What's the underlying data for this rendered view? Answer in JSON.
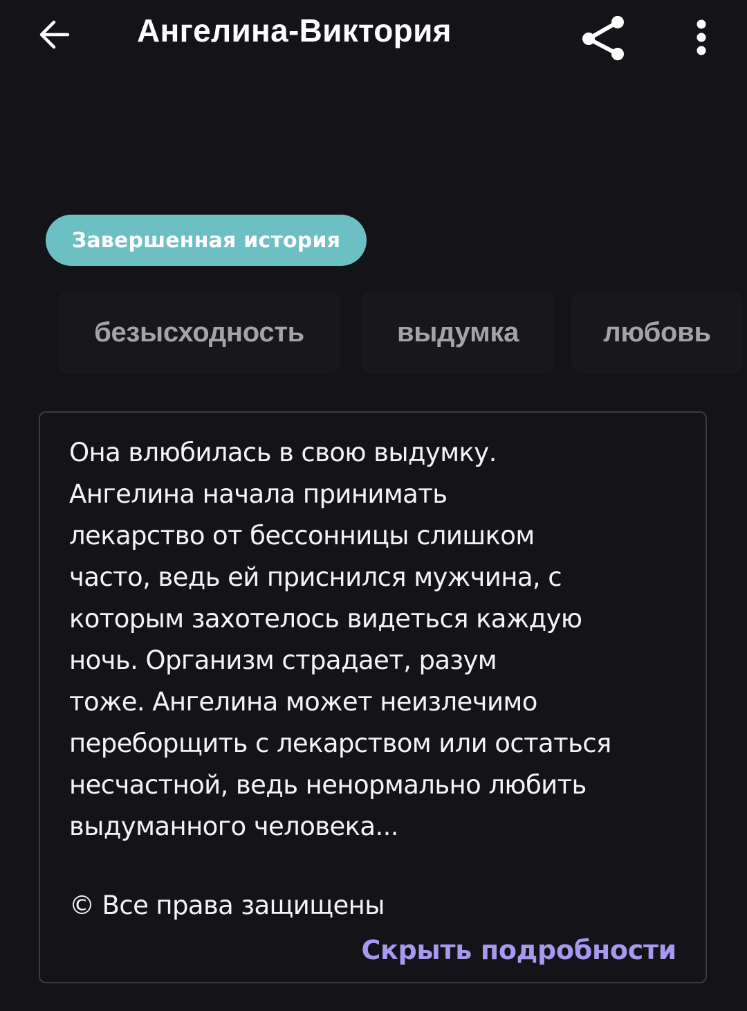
{
  "header": {
    "title": "Ангелина-Виктория",
    "back_icon": "arrow-left-icon",
    "share_icon": "share-icon",
    "more_icon": "more-vertical-icon"
  },
  "status_badge": {
    "label": "Завершенная история",
    "color": "#6cbfc3"
  },
  "tags": [
    {
      "label": "безысходность"
    },
    {
      "label": "выдумка"
    },
    {
      "label": "любовь"
    }
  ],
  "description": {
    "text": "Она влюбилась в свою выдумку.\nАнгелина начала принимать\nлекарство от бессонницы слишком\nчасто, ведь ей приснился мужчина, с\nкоторым захотелось видеться каждую\nночь. Организм страдает, разум\nтоже. Ангелина может неизлечимо\nпереборщить с лекарством или остаться\nнесчастной, ведь ненормально любить\nвыдуманного человека...",
    "copyright": "© Все права защищены",
    "hide_link": "Скрыть подробности",
    "link_color": "#a59af0"
  },
  "colors": {
    "background": "#141317",
    "tag_text": "#a4a4a8",
    "box_border": "#3a3a40"
  }
}
